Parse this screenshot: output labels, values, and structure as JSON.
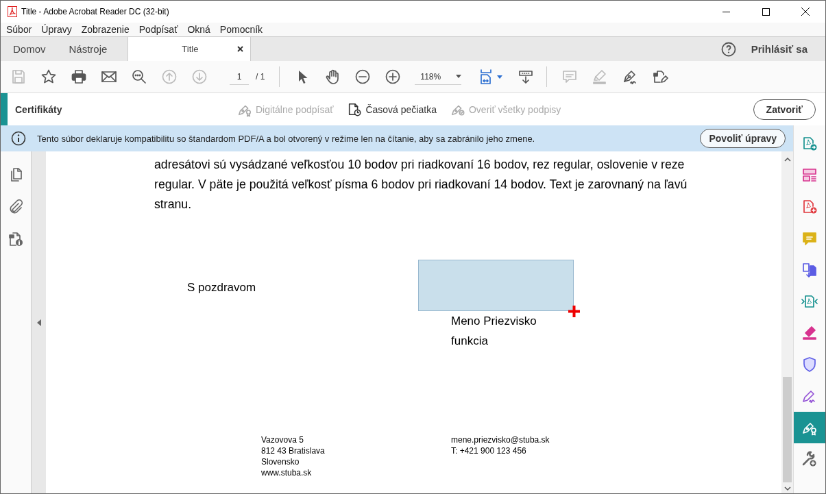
{
  "window": {
    "title": "Title - Adobe Acrobat Reader DC (32-bit)"
  },
  "menu": [
    "Súbor",
    "Úpravy",
    "Zobrazenie",
    "Podpísať",
    "Okná",
    "Pomocník"
  ],
  "tabs": [
    {
      "label": "Domov",
      "kind": "nav",
      "selected": false
    },
    {
      "label": "Nástroje",
      "kind": "nav",
      "selected": false
    },
    {
      "label": "Title",
      "kind": "document",
      "selected": true
    }
  ],
  "account": {
    "label": "Prihlásiť sa"
  },
  "toolbar": {
    "file_tools": [
      {
        "kind": "save",
        "disabled": true
      },
      {
        "kind": "bookmark",
        "disabled": false
      },
      {
        "kind": "print",
        "disabled": false
      },
      {
        "kind": "email",
        "disabled": false
      },
      {
        "kind": "find",
        "disabled": false
      },
      {
        "kind": "prev-page",
        "disabled": true
      },
      {
        "kind": "next-page",
        "disabled": true
      }
    ],
    "page": {
      "current": "1",
      "total": "/ 1"
    },
    "view_tools": [
      {
        "kind": "select",
        "disabled": false
      },
      {
        "kind": "hand",
        "disabled": false
      },
      {
        "kind": "zoom-out",
        "disabled": false
      },
      {
        "kind": "zoom-in",
        "disabled": false
      }
    ],
    "zoom": {
      "value": "118%"
    },
    "layout_tools": [
      {
        "kind": "fit-page",
        "disabled": false
      },
      {
        "kind": "read-mode",
        "disabled": false
      }
    ],
    "annotation_tools": [
      {
        "kind": "comment",
        "disabled": true
      },
      {
        "kind": "highlight",
        "disabled": true
      },
      {
        "kind": "sign",
        "disabled": false
      },
      {
        "kind": "fill-sign",
        "disabled": false
      }
    ]
  },
  "certificates": {
    "title": "Certifikáty",
    "actions": [
      {
        "label": "Digitálne podpísať",
        "kind": "sign",
        "disabled": true
      },
      {
        "label": "Časová pečiatka",
        "kind": "timestamp",
        "disabled": false
      },
      {
        "label": "Overiť všetky podpisy",
        "kind": "verify",
        "disabled": true
      }
    ],
    "close_button": "Zatvoriť"
  },
  "notice": {
    "text": "Tento súbor deklaruje kompatibilitu so štandardom PDF/A a bol otvorený v režime len na čítanie, aby sa zabránilo jeho zmene.",
    "button": "Povoliť úpravy"
  },
  "document": {
    "paragraph": "adresátovi sú vysádzané veľkosťou 10 bodov pri riadkovaní 16 bodov, rez regular, oslovenie v reze regular. V päte je použitá veľkosť písma 6 bodov pri riadkovaní 14 bodov. Text je zarovnaný na ľavú stranu.",
    "closing": "S pozdravom",
    "signer_name": "Meno Priezvisko",
    "signer_role": "funkcia",
    "footer_address": [
      "Vazovova 5",
      "812 43 Bratislava",
      "Slovensko",
      "www.stuba.sk"
    ],
    "footer_contact": [
      "mene.priezvisko@stuba.sk",
      "T: +421 900 123 456"
    ]
  },
  "tool_pane": [
    {
      "kind": "export-pdf",
      "selected": false
    },
    {
      "kind": "organize",
      "selected": false
    },
    {
      "kind": "create-pdf",
      "selected": false
    },
    {
      "kind": "comment",
      "selected": false
    },
    {
      "kind": "combine",
      "selected": false
    },
    {
      "kind": "compress",
      "selected": false
    },
    {
      "kind": "fill",
      "selected": false
    },
    {
      "kind": "protect",
      "selected": false
    },
    {
      "kind": "sign",
      "selected": false
    },
    {
      "kind": "certificate",
      "selected": true
    },
    {
      "kind": "more-tools",
      "selected": false
    }
  ]
}
